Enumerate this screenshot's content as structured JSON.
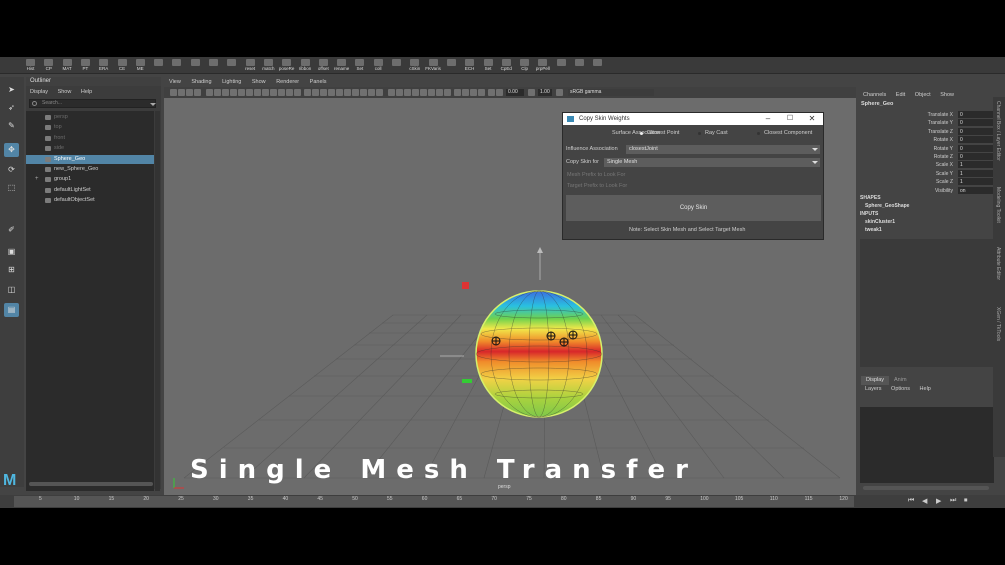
{
  "shelf": {
    "buttons": [
      "Hist",
      "CP",
      "MAT",
      "PT",
      "ERA",
      "CE",
      "ME",
      "",
      "",
      "",
      "",
      "",
      "reset",
      "match",
      "poseRe",
      "ribbon",
      "offset",
      "rename",
      "Set",
      "coll",
      "",
      "cSkin",
      "FKVaris",
      "",
      "ECH",
      "Set",
      "CpEd",
      "Clp",
      "prpPell",
      "",
      "",
      ""
    ]
  },
  "outliner": {
    "title": "Outliner",
    "menu": [
      "Display",
      "Show",
      "Help"
    ],
    "search_placeholder": "Search...",
    "items": [
      {
        "label": "persp",
        "dim": true,
        "indent": 0
      },
      {
        "label": "top",
        "dim": true,
        "indent": 0
      },
      {
        "label": "front",
        "dim": true,
        "indent": 0
      },
      {
        "label": "side",
        "dim": true,
        "indent": 0
      },
      {
        "label": "Sphere_Geo",
        "selected": true,
        "indent": 0
      },
      {
        "label": "new_Sphere_Geo",
        "indent": 0
      },
      {
        "label": "group1",
        "indent": 0,
        "expandable": true
      },
      {
        "label": "defaultLightSet",
        "indent": 0
      },
      {
        "label": "defaultObjectSet",
        "indent": 0
      }
    ]
  },
  "viewport": {
    "menu": [
      "View",
      "Shading",
      "Lighting",
      "Show",
      "Renderer",
      "Panels"
    ],
    "field1": "0.00",
    "field2": "1.00",
    "colorspace": "sRGB gamma",
    "camera_label": "persp"
  },
  "dialog": {
    "title": "Copy Skin Weights",
    "surface_label": "Surface Association",
    "surface_options": [
      "Closest Point",
      "Ray Cast",
      "Closest Component"
    ],
    "influence_label": "Influence Association",
    "influence_value": "closestJoint",
    "copy_for_label": "Copy Skin for",
    "copy_for_value": "Single Mesh",
    "prefix1": "Mesh Prefix to Look For",
    "prefix2": "Target Prefix to Look For",
    "button": "Copy Skin",
    "note": "Note: Select Skin Mesh and Select Target Mesh"
  },
  "channelbox": {
    "menu": [
      "Channels",
      "Edit",
      "Object",
      "Show"
    ],
    "object": "Sphere_Geo",
    "attributes": [
      {
        "name": "Translate X",
        "value": "0"
      },
      {
        "name": "Translate Y",
        "value": "0"
      },
      {
        "name": "Translate Z",
        "value": "0"
      },
      {
        "name": "Rotate X",
        "value": "0"
      },
      {
        "name": "Rotate Y",
        "value": "0"
      },
      {
        "name": "Rotate Z",
        "value": "0"
      },
      {
        "name": "Scale X",
        "value": "1"
      },
      {
        "name": "Scale Y",
        "value": "1"
      },
      {
        "name": "Scale Z",
        "value": "1"
      },
      {
        "name": "Visibility",
        "value": "on"
      }
    ],
    "shapes_header": "SHAPES",
    "shape": "Sphere_GeoShape",
    "inputs_header": "INPUTS",
    "inputs": [
      "skinCluster1",
      "tweak1"
    ],
    "layer_tabs": [
      "Display",
      "Anim"
    ],
    "layer_menu": [
      "Layers",
      "Options",
      "Help"
    ],
    "side_tabs": [
      "Channel Box / Layer Editor",
      "Modeling Toolkit",
      "Attribute Editor",
      "XGen / TkTools"
    ]
  },
  "timeline": {
    "ticks": [
      "5",
      "10",
      "15",
      "20",
      "25",
      "30",
      "35",
      "40",
      "45",
      "50",
      "55",
      "60",
      "65",
      "70",
      "75",
      "80",
      "85",
      "90",
      "95",
      "100",
      "105",
      "110",
      "115",
      "120"
    ]
  },
  "caption": "Single Mesh Transfer",
  "colors": {
    "selection": "#5285a6",
    "viewport_bg": "#6c6c6c",
    "panel_bg": "#444444"
  }
}
